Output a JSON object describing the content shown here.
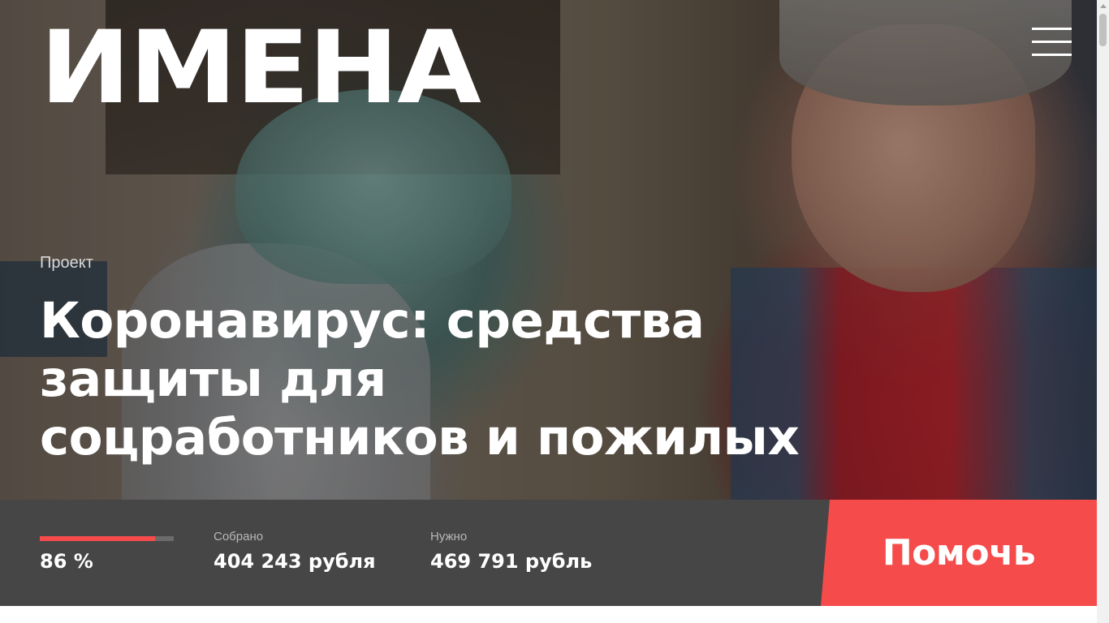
{
  "header": {
    "logo_text": "ИМЕНА",
    "menu_icon": "hamburger-menu-icon"
  },
  "hero": {
    "kicker": "Проект",
    "title": "Коронавирус: средства защиты для соцработников и пожилых"
  },
  "fundraising": {
    "progress_percent": 86,
    "progress_label": "86 %",
    "collected_label": "Собрано",
    "collected_value": "404 243 рубля",
    "needed_label": "Нужно",
    "needed_value": "469 791 рубль",
    "help_button_label": "Помочь"
  },
  "colors": {
    "accent": "#f64b4b",
    "stats_background": "#464646",
    "progress_track": "#6b6b6b"
  }
}
